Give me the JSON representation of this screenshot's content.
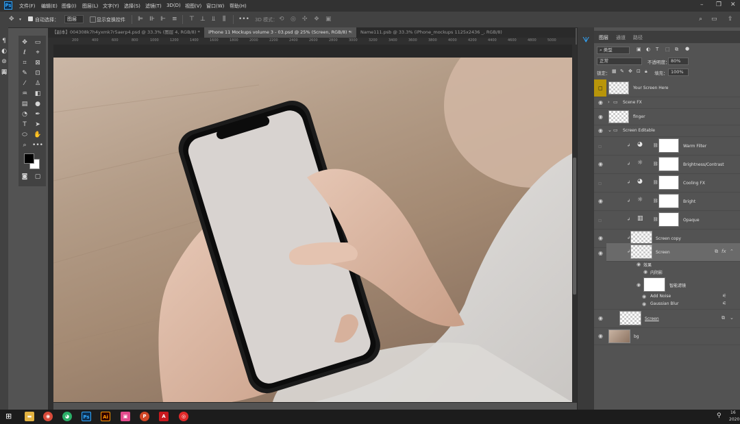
{
  "menubar": {
    "logo": "Ps",
    "items": [
      "文件(F)",
      "编辑(E)",
      "图像(I)",
      "图层(L)",
      "文字(Y)",
      "选择(S)",
      "滤镜(T)",
      "3D(D)",
      "视图(V)",
      "窗口(W)",
      "帮助(H)"
    ]
  },
  "optbar": {
    "auto_select_label": "自动选择：",
    "auto_select_value": "图层",
    "show_transform_label": "显示变换控件",
    "mode_3d": "3D 模式："
  },
  "doc_tabs": [
    {
      "label": "【副本】004308k7h4yxmk7r5aerp4.psd @ 33.3% (图层 4, RGB/8) *",
      "active": false
    },
    {
      "label": "iPhone 11 Mockups volume 3 - 03.psd @ 25% (Screen, RGB/8) *",
      "active": true
    },
    {
      "label": "Name111.psb @ 33.3% (iPhone_mockups 1125x2436 _, RGB/8)",
      "active": false
    }
  ],
  "ruler_ticks": [
    "200",
    "400",
    "600",
    "800",
    "1000",
    "1200",
    "1400",
    "1600",
    "1800",
    "2000",
    "2200",
    "2400",
    "2600",
    "2800",
    "3000",
    "3200",
    "3400",
    "3600",
    "3800",
    "4000",
    "4200",
    "4400",
    "4600",
    "4800",
    "5000"
  ],
  "panel": {
    "tabs": [
      "图层",
      "通道",
      "路径"
    ],
    "filter_kind": "类型",
    "blend_mode": "正常",
    "opacity_label": "不透明度：",
    "opacity_value": "80%",
    "lock_label": "锁定：",
    "fill_label": "填充：",
    "fill_value": "100%"
  },
  "layers": [
    {
      "name": "Your Screen Here"
    },
    {
      "name": "Scene FX"
    },
    {
      "name": "finger"
    },
    {
      "name": "Screen Editable"
    },
    {
      "name": "Warm Filter"
    },
    {
      "name": "Brightness/Contrast"
    },
    {
      "name": "Cooling FX"
    },
    {
      "name": "Bright"
    },
    {
      "name": "Opaque"
    },
    {
      "name": "Screen copy"
    },
    {
      "name": "Screen"
    },
    {
      "name": "效果"
    },
    {
      "name": "内阴影"
    },
    {
      "name": "智能滤镜"
    },
    {
      "name": "Add Noise"
    },
    {
      "name": "Gaussian Blur"
    },
    {
      "name": "Screen"
    },
    {
      "name": "bg"
    }
  ],
  "taskbar": {
    "clock_time": "16",
    "clock_year": "2020"
  },
  "colors": {
    "ps_blue": "#31a8ff",
    "canvas_bg": "#282828",
    "panel_bg": "#535353",
    "selected_layer": "#6a6a6a",
    "warm_swatch": "#b8950a"
  }
}
